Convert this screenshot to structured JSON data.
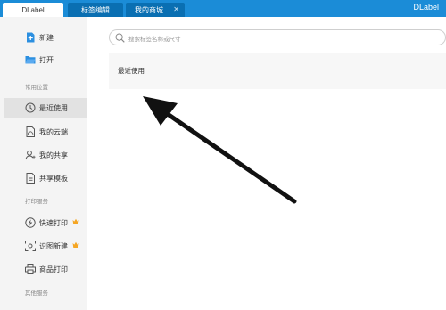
{
  "tabs": [
    {
      "label": "DLabel"
    },
    {
      "label": "标签编辑"
    },
    {
      "label": "我的商城",
      "close": "✕"
    }
  ],
  "brand": "DLabel",
  "sidebar": {
    "actions": [
      {
        "label": "新建",
        "icon": "new-file-icon"
      },
      {
        "label": "打开",
        "icon": "folder-open-icon"
      }
    ],
    "section_common": "常用位置",
    "common": [
      {
        "label": "最近使用",
        "icon": "clock-icon"
      },
      {
        "label": "我的云端",
        "icon": "cloud-document-icon"
      },
      {
        "label": "我的共享",
        "icon": "user-share-icon"
      },
      {
        "label": "共享模板",
        "icon": "template-icon"
      }
    ],
    "section_print": "打印服务",
    "print": [
      {
        "label": "快速打印",
        "icon": "lightning-icon"
      },
      {
        "label": "识图新建",
        "icon": "scan-icon"
      },
      {
        "label": "商品打印",
        "icon": "printer-icon"
      }
    ],
    "section_other": "其他服务"
  },
  "search": {
    "placeholder": "搜索标签名称或尺寸"
  },
  "main": {
    "recent_title": "最近使用"
  },
  "colors": {
    "titlebar": "#1b8cd7",
    "tab_dark": "#0a6fb2",
    "accent": "#2b8fe0",
    "badge": "#f5a623"
  }
}
